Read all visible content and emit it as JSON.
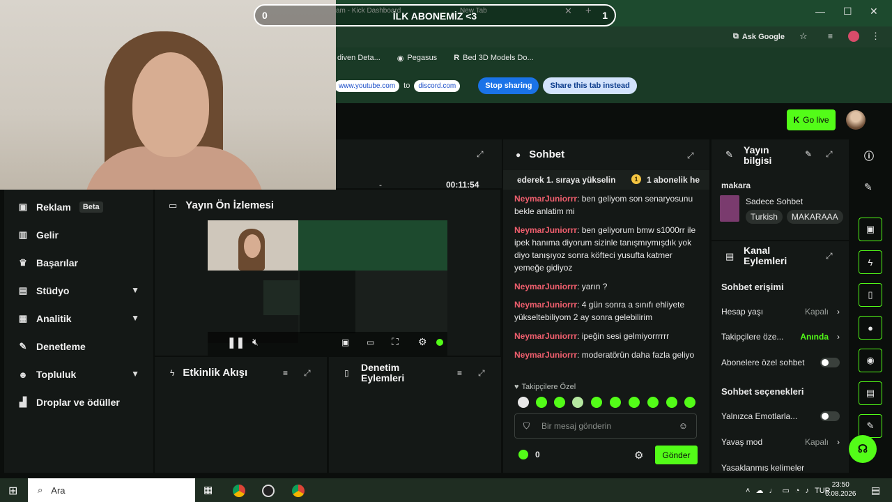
{
  "overlay": {
    "left_count": "0",
    "right_count": "1",
    "banner": "İLK ABONEMİZ <3"
  },
  "browser": {
    "tab_title": "am - Kick Dashboard",
    "tab2_title": "New Tab",
    "ask_google": "Ask Google",
    "bookmarks": [
      "diven Deta...",
      "Pegasus",
      "Bed 3D Models Do..."
    ],
    "share_bar": {
      "from_url": "www.youtube.com",
      "to_word": "to",
      "to_url": "discord.com",
      "stop": "Stop sharing",
      "share_this": "Share this tab instead"
    }
  },
  "header": {
    "go_live": "Go live"
  },
  "sidebar": {
    "items": [
      {
        "label": "Reklam",
        "badge": "Beta",
        "icon": "ad-icon"
      },
      {
        "label": "Gelir",
        "icon": "revenue-icon"
      },
      {
        "label": "Başarılar",
        "icon": "trophy-icon"
      },
      {
        "label": "Stüdyo",
        "icon": "studio-icon"
      },
      {
        "label": "Analitik",
        "icon": "analytics-icon"
      },
      {
        "label": "Denetleme",
        "icon": "wrench-icon"
      },
      {
        "label": "Topluluk",
        "icon": "community-icon"
      },
      {
        "label": "Droplar ve ödüller",
        "icon": "drops-icon"
      }
    ]
  },
  "stream_stats": {
    "viewers": "-",
    "duration": "00:11:54"
  },
  "preview": {
    "title": "Yayın Ön İzlemesi"
  },
  "activity": {
    "title": "Etkinlik Akışı"
  },
  "moderation": {
    "title_line1": "Denetim",
    "title_line2": "Eylemleri"
  },
  "chat": {
    "title": "Sohbet",
    "pinned_left": "ederek 1. sıraya yükselin",
    "pinned_right": "1 abonelik he",
    "messages": [
      {
        "user": "NeymarJuniorrr",
        "text": "ben geliyom son senaryosunu bekle anlatim mi"
      },
      {
        "user": "NeymarJuniorrr",
        "text": "ben geliyorum bmw s1000rr ile ipek hanıma diyorum sizinle tanışmıymışdık yok diyo tanışıyoz sonra köfteci yusufta katmer yemeğe gidiyoz"
      },
      {
        "user": "NeymarJuniorrr",
        "text": "yarın ?"
      },
      {
        "user": "NeymarJuniorrr",
        "text": "4 gün sonra a sınıfı ehliyete yükseltebiliyom 2 ay sonra gelebilirim"
      },
      {
        "user": "NeymarJuniorrr",
        "text": "ipeğin sesi gelmiyorrrrrr"
      },
      {
        "user": "NeymarJuniorrr",
        "text": "moderatörün daha fazla geliyo"
      }
    ],
    "followers_only": "Takipçilere Özel",
    "input_placeholder": "Bir mesaj gönderin",
    "points": "0",
    "send": "Gönder"
  },
  "stream_info": {
    "title_line1": "Yayın",
    "title_line2": "bilgisi",
    "stream_title": "makara",
    "category": "Sadece Sohbet",
    "tags": [
      "Turkish",
      "MAKARAAA"
    ]
  },
  "channel_actions": {
    "title_line1": "Kanal",
    "title_line2": "Eylemleri",
    "chat_access": "Sohbet erişimi",
    "account_age": {
      "label": "Hesap yaşı",
      "value": "Kapalı"
    },
    "followers_only": {
      "label": "Takipçilere öze...",
      "value": "Anında"
    },
    "subs_only": {
      "label": "Abonelere özel sohbet"
    },
    "chat_options": "Sohbet seçenekleri",
    "emote_only": {
      "label": "Yalnızca Emotlarla..."
    },
    "slow_mode": {
      "label": "Yavaş mod",
      "value": "Kapalı"
    },
    "banned_words": {
      "label": "Yasaklanmış kelimeler"
    }
  },
  "taskbar": {
    "search": "Ara",
    "lang": "TUR",
    "time": "23:50",
    "date": "6.08.2026"
  },
  "colors": {
    "accent": "#53fc18",
    "username": "#f15f6e",
    "panel": "#141816",
    "bg": "#0b0e0c"
  }
}
